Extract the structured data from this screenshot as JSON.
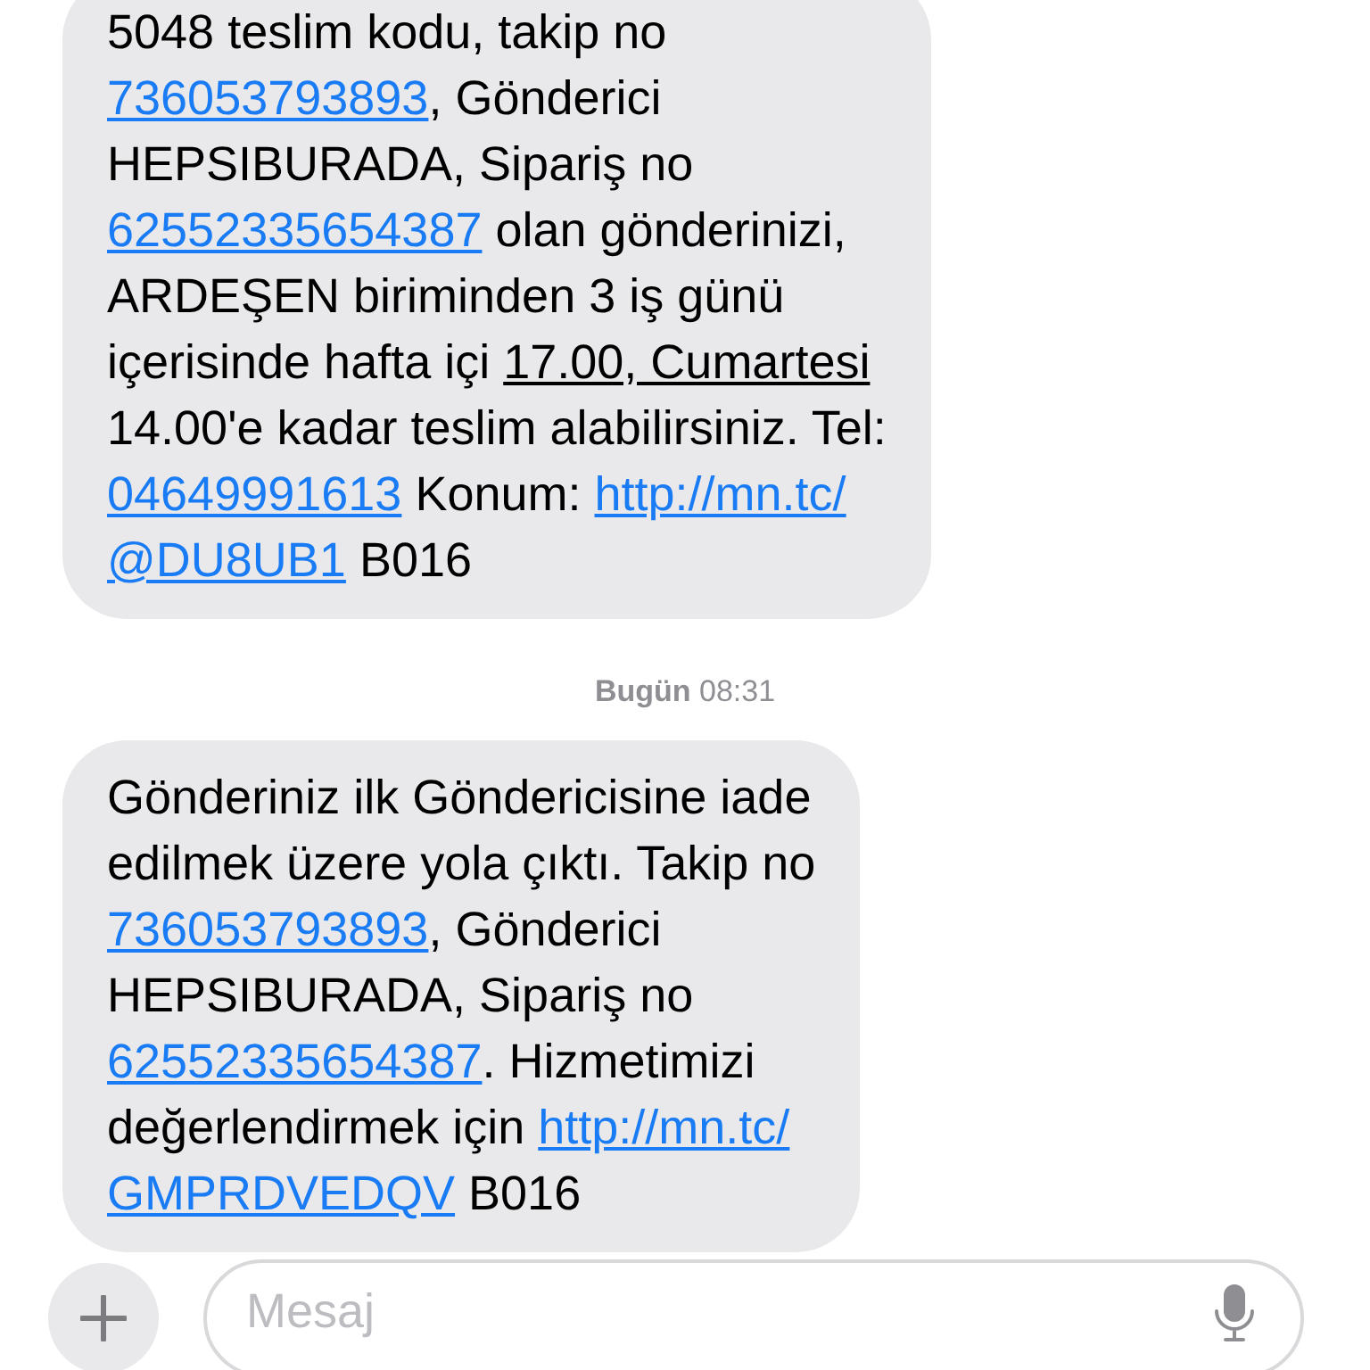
{
  "messages": [
    {
      "lines": [
        [
          {
            "kind": "plain",
            "text": "5048 teslim kodu, takip no"
          }
        ],
        [
          {
            "kind": "link",
            "text": "736053793893"
          },
          {
            "kind": "plain",
            "text": ", Gönderici"
          }
        ],
        [
          {
            "kind": "plain",
            "text": "HEPSIBURADA, Sipariş no"
          }
        ],
        [
          {
            "kind": "link",
            "text": "62552335654387"
          },
          {
            "kind": "plain",
            "text": " olan gönderinizi,"
          }
        ],
        [
          {
            "kind": "plain",
            "text": "ARDEŞEN biriminden 3 iş günü"
          }
        ],
        [
          {
            "kind": "plain",
            "text": "içerisinde hafta içi "
          },
          {
            "kind": "date",
            "text": "17.00, Cumartesi"
          }
        ],
        [
          {
            "kind": "plain",
            "text": "14.00'e kadar teslim alabilirsiniz. Tel:"
          }
        ],
        [
          {
            "kind": "link",
            "text": "04649991613"
          },
          {
            "kind": "plain",
            "text": " Konum: "
          },
          {
            "kind": "link",
            "text": "http://mn.tc/"
          }
        ],
        [
          {
            "kind": "link",
            "text": "@DU8UB1"
          },
          {
            "kind": "plain",
            "text": " B016"
          }
        ]
      ]
    },
    {
      "timestamp": "**Bugün** 08:31",
      "lines": [
        [
          {
            "kind": "plain",
            "text": "Gönderiniz ilk Göndericisine iade"
          }
        ],
        [
          {
            "kind": "plain",
            "text": "edilmek üzere yola çıktı. Takip no"
          }
        ],
        [
          {
            "kind": "link",
            "text": "736053793893"
          },
          {
            "kind": "plain",
            "text": ", Gönderici"
          }
        ],
        [
          {
            "kind": "plain",
            "text": "HEPSIBURADA, Sipariş no"
          }
        ],
        [
          {
            "kind": "link",
            "text": "62552335654387"
          },
          {
            "kind": "plain",
            "text": ". Hizmetimizi"
          }
        ],
        [
          {
            "kind": "plain",
            "text": "değerlendirmek için "
          },
          {
            "kind": "link",
            "text": "http://mn.tc/"
          }
        ],
        [
          {
            "kind": "link",
            "text": "GMPRDVEDQV"
          },
          {
            "kind": "plain",
            "text": " B016"
          }
        ]
      ]
    }
  ],
  "composer": {
    "placeholder": "Mesaj"
  }
}
